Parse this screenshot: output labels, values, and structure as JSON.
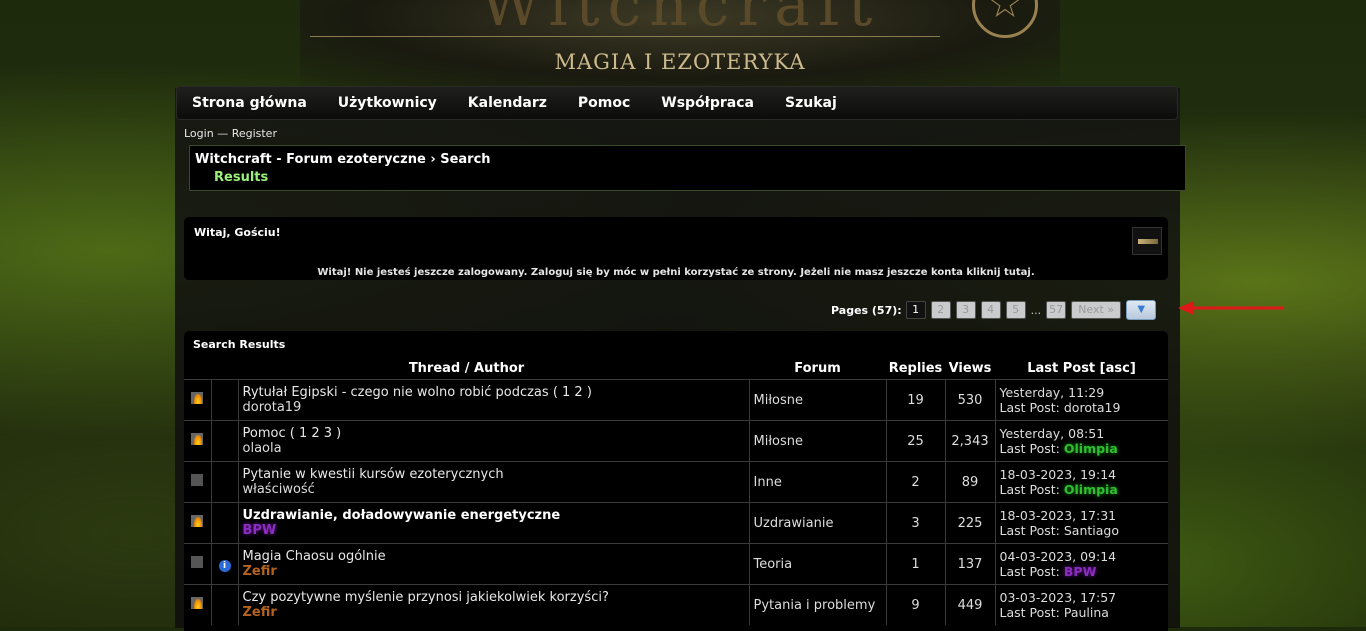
{
  "banner": {
    "title": "Witchcraft",
    "subtitle": "MAGIA I EZOTERYKA"
  },
  "nav": [
    "Strona główna",
    "Użytkownicy",
    "Kalendarz",
    "Pomoc",
    "Współpraca",
    "Szukaj"
  ],
  "login": {
    "login": "Login",
    "sep": "—",
    "register": "Register"
  },
  "breadcrumb": {
    "forum": "Witchcraft - Forum ezoteryczne",
    "sep": "›",
    "search": "Search",
    "current": "Results"
  },
  "welcome": {
    "title": "Witaj, Gościu!",
    "text": "Witaj! Nie jesteś jeszcze zalogowany. Zaloguj się by móc w pełni korzystać ze strony. Jeżeli nie masz jeszcze konta kliknij tutaj."
  },
  "pagination": {
    "label": "Pages (57):",
    "pages": [
      "1",
      "2",
      "3",
      "4",
      "5"
    ],
    "ellipsis": "...",
    "last": "57",
    "next": "Next »"
  },
  "results": {
    "title": "Search Results",
    "headers": {
      "thread": "Thread / Author",
      "forum": "Forum",
      "replies": "Replies",
      "views": "Views",
      "lastpost": "Last Post [asc]"
    },
    "rows": [
      {
        "icon": "hot-folder-icon",
        "prefix": "",
        "subject": "Rytułał Egipski - czego nie wolno robić podczas",
        "pages": "( 1 2 )",
        "author": "dorota19",
        "author_style": "plain",
        "forum": "Miłosne",
        "replies": "19",
        "views": "530",
        "lp_date": "Yesterday, 11:29",
        "lp_label": "Last Post:",
        "lp_user": "dorota19",
        "lp_user_style": "plain"
      },
      {
        "icon": "hot-folder-icon",
        "prefix": "",
        "subject": "Pomoc",
        "pages": "( 1 2 3 )",
        "author": "olaola",
        "author_style": "plain",
        "forum": "Miłosne",
        "replies": "25",
        "views": "2,343",
        "views_dim": true,
        "lp_date": "Yesterday, 08:51",
        "lp_label": "Last Post:",
        "lp_user": "Olimpia",
        "lp_user_style": "green"
      },
      {
        "icon": "folder-icon",
        "prefix": "",
        "subject": "Pytanie w kwestii kursów ezoterycznych",
        "pages": "",
        "author": "właściwość",
        "author_style": "plain",
        "forum": "Inne",
        "replies": "2",
        "views": "89",
        "lp_date": "18-03-2023, 19:14",
        "lp_label": "Last Post:",
        "lp_user": "Olimpia",
        "lp_user_style": "green"
      },
      {
        "icon": "hot-folder-icon",
        "prefix": "",
        "subject": "Uzdrawianie, doładowywanie energetyczne",
        "subject_bold": true,
        "pages": "",
        "author": "BPW",
        "author_style": "purple",
        "forum": "Uzdrawianie",
        "replies": "3",
        "views": "225",
        "views_dim": true,
        "lp_date": "18-03-2023, 17:31",
        "lp_label": "Last Post:",
        "lp_user": "Santiago",
        "lp_user_style": "plain"
      },
      {
        "icon": "folder-icon",
        "prefix": "info",
        "subject": "Magia Chaosu ogólnie",
        "pages": "",
        "author": "Zefir",
        "author_style": "orange",
        "forum": "Teoria",
        "replies": "1",
        "views": "137",
        "lp_date": "04-03-2023, 09:14",
        "lp_label": "Last Post:",
        "lp_user": "BPW",
        "lp_user_style": "purple"
      },
      {
        "icon": "hot-folder-icon",
        "prefix": "",
        "subject": "Czy pozytywne myślenie przynosi jakiekolwiek korzyści?",
        "pages": "",
        "author": "Zefir",
        "author_style": "orange",
        "forum": "Pytania i problemy",
        "replies": "9",
        "views": "449",
        "views_dim": true,
        "lp_date": "03-03-2023, 17:57",
        "lp_label": "Last Post:",
        "lp_user": "Paulina",
        "lp_user_style": "plain"
      }
    ]
  },
  "colors": {
    "accent_green": "#9bf07a",
    "arrow_red": "#e01818",
    "user_purple": "#8b2dbf",
    "user_green": "#2fbf2f",
    "user_orange": "#b5621f"
  }
}
